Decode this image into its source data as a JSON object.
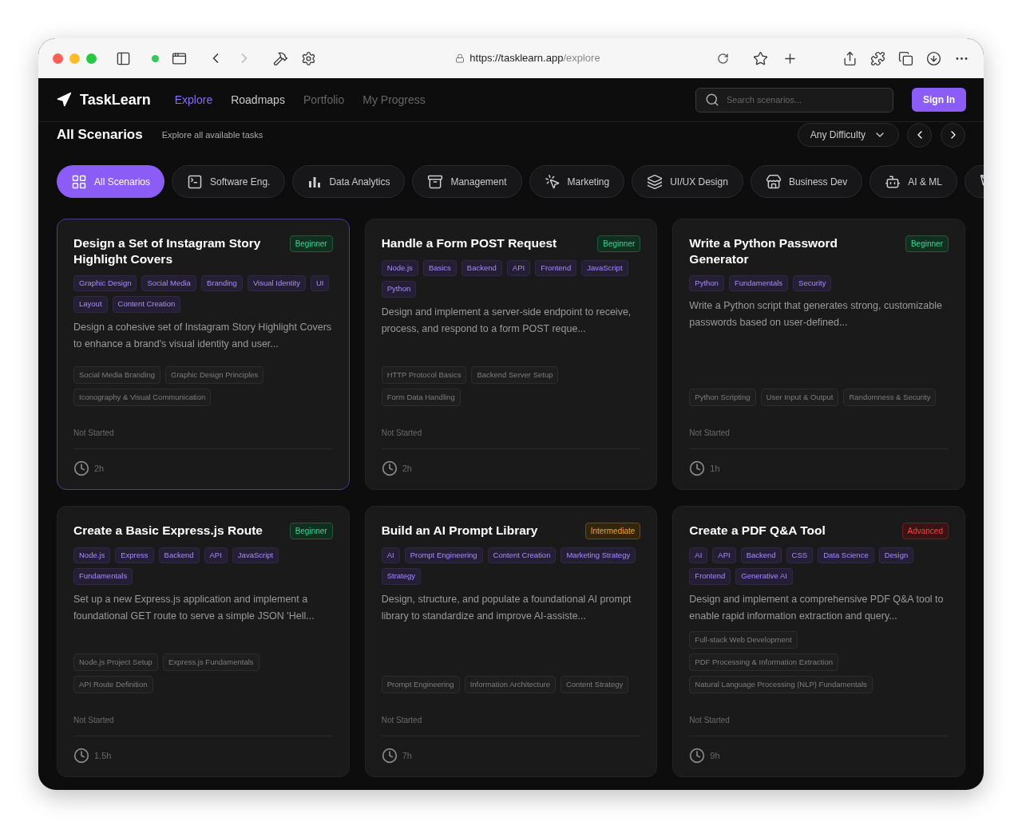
{
  "browser": {
    "url_host": "https://tasklearn.app",
    "url_path": "/explore"
  },
  "app": {
    "brand": "TaskLearn",
    "nav": [
      {
        "label": "Explore",
        "selected": true,
        "disabled": false
      },
      {
        "label": "Roadmaps",
        "selected": false,
        "disabled": false
      },
      {
        "label": "Portfolio",
        "selected": false,
        "disabled": true
      },
      {
        "label": "My Progress",
        "selected": false,
        "disabled": true
      }
    ],
    "search": {
      "placeholder": "Search scenarios..."
    },
    "sign_in": "Sign In"
  },
  "header": {
    "title": "All Scenarios",
    "subtitle": "Explore all available tasks",
    "difficulty_filter": "Any Difficulty"
  },
  "categories": [
    {
      "label": "All Scenarios",
      "selected": true
    },
    {
      "label": "Software Eng.",
      "selected": false
    },
    {
      "label": "Data Analytics",
      "selected": false
    },
    {
      "label": "Management",
      "selected": false
    },
    {
      "label": "Marketing",
      "selected": false
    },
    {
      "label": "UI/UX Design",
      "selected": false
    },
    {
      "label": "Business Dev",
      "selected": false
    },
    {
      "label": "AI & ML",
      "selected": false
    },
    {
      "selected": false
    }
  ],
  "cards": [
    {
      "title": "Design a Set of Instagram Story Highlight Covers",
      "selected": true,
      "difficulty": {
        "label": "Beginner",
        "kind": "beginner"
      },
      "tags": [
        "Graphic Design",
        "Social Media",
        "Branding",
        "Visual Identity",
        "UI",
        "Layout",
        "Content Creation"
      ],
      "description": "Design a cohesive set of Instagram Story Highlight Covers to enhance a brand's visual identity and user...",
      "skills": [
        "Social Media Branding",
        "Graphic Design Principles",
        "Iconography & Visual Communication"
      ],
      "status": "Not Started",
      "duration": "2h"
    },
    {
      "title": "Handle a Form POST Request",
      "selected": false,
      "difficulty": {
        "label": "Beginner",
        "kind": "beginner"
      },
      "tags": [
        "Node.js",
        "Basics",
        "Backend",
        "API",
        "Frontend",
        "JavaScript",
        "Python"
      ],
      "description": "Design and implement a server-side endpoint to receive, process, and respond to a form POST reque...",
      "skills": [
        "HTTP Protocol Basics",
        "Backend Server Setup",
        "Form Data Handling"
      ],
      "status": "Not Started",
      "duration": "2h"
    },
    {
      "title": "Write a Python Password Generator",
      "selected": false,
      "difficulty": {
        "label": "Beginner",
        "kind": "beginner"
      },
      "tags": [
        "Python",
        "Fundamentals",
        "Security"
      ],
      "description": "Write a Python script that generates strong, customizable passwords based on user-defined...",
      "skills": [
        "Python Scripting",
        "User Input & Output",
        "Randomness & Security"
      ],
      "status": "Not Started",
      "duration": "1h"
    },
    {
      "title": "Create a Basic Express.js Route",
      "selected": false,
      "difficulty": {
        "label": "Beginner",
        "kind": "beginner"
      },
      "tags": [
        "Node.js",
        "Express",
        "Backend",
        "API",
        "JavaScript",
        "Fundamentals"
      ],
      "description": "Set up a new Express.js application and implement a foundational GET route to serve a simple JSON 'Hell...",
      "skills": [
        "Node.js Project Setup",
        "Express.js Fundamentals",
        "API Route Definition"
      ],
      "status": "Not Started",
      "duration": "1.5h"
    },
    {
      "title": "Build an AI Prompt Library",
      "selected": false,
      "difficulty": {
        "label": "Intermediate",
        "kind": "intermediate"
      },
      "tags": [
        "AI",
        "Prompt Engineering",
        "Content Creation",
        "Marketing Strategy",
        "Strategy"
      ],
      "description": "Design, structure, and populate a foundational AI prompt library to standardize and improve AI-assiste...",
      "skills": [
        "Prompt Engineering",
        "Information Architecture",
        "Content Strategy"
      ],
      "status": "Not Started",
      "duration": "7h"
    },
    {
      "title": "Create a PDF Q&A Tool",
      "selected": false,
      "difficulty": {
        "label": "Advanced",
        "kind": "advanced"
      },
      "tags": [
        "AI",
        "API",
        "Backend",
        "CSS",
        "Data Science",
        "Design",
        "Frontend",
        "Generative AI"
      ],
      "description": "Design and implement a comprehensive PDF Q&A tool to enable rapid information extraction and query...",
      "skills": [
        "Full-stack Web Development",
        "PDF Processing & Information Extraction",
        "Natural Language Processing (NLP) Fundamentals"
      ],
      "status": "Not Started",
      "duration": "9h"
    }
  ]
}
